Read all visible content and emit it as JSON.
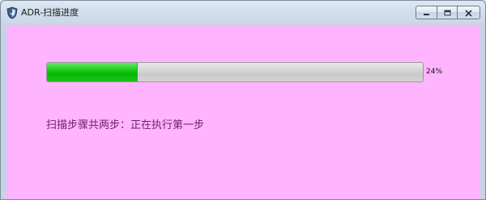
{
  "window": {
    "title": "ADR-扫描进度",
    "client_background": "#ffb4ff"
  },
  "caption_buttons": {
    "minimize_icon": "minimize-icon",
    "maximize_icon": "maximize-icon",
    "close_icon": "close-icon"
  },
  "progress": {
    "value": 0.24,
    "percent_label": "24%",
    "fill_color": "#0dbb0d"
  },
  "status": {
    "message": "扫描步骤共两步：正在执行第一步",
    "color": "#6d1f6d"
  }
}
